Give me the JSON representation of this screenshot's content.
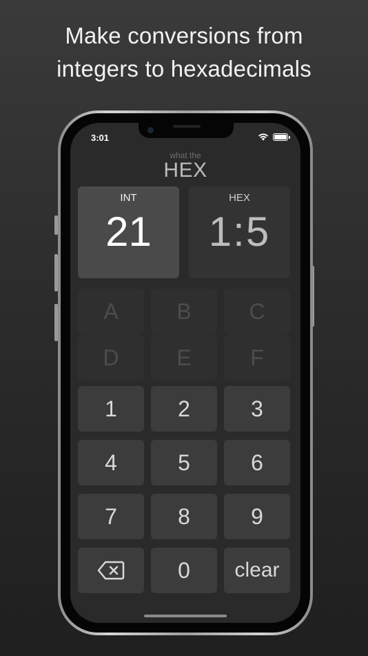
{
  "headline": {
    "line1": "Make conversions from",
    "line2": "integers to hexadecimals"
  },
  "status_bar": {
    "time": "3:01",
    "icons": [
      "wifi-icon",
      "battery-icon"
    ]
  },
  "app": {
    "subtitle": "what the",
    "title": "HEX"
  },
  "int_panel": {
    "label": "INT",
    "value": "21"
  },
  "hex_panel": {
    "label": "HEX",
    "value": "1:5"
  },
  "hex_keys": [
    {
      "label": "A"
    },
    {
      "label": "B"
    },
    {
      "label": "C"
    },
    {
      "label": "D"
    },
    {
      "label": "E"
    },
    {
      "label": "F"
    }
  ],
  "num_keys": [
    {
      "label": "1"
    },
    {
      "label": "2"
    },
    {
      "label": "3"
    },
    {
      "label": "4"
    },
    {
      "label": "5"
    },
    {
      "label": "6"
    },
    {
      "label": "7"
    },
    {
      "label": "8"
    },
    {
      "label": "9"
    }
  ],
  "bottom_keys": {
    "backspace_icon": "backspace-icon",
    "zero": "0",
    "clear": "clear"
  },
  "colors": {
    "background": "#2c2c2c",
    "int_panel": "#4a4a4a",
    "hex_panel": "#333333",
    "key_active": "#3c3c3c",
    "key_disabled": "#2f2f2f"
  }
}
